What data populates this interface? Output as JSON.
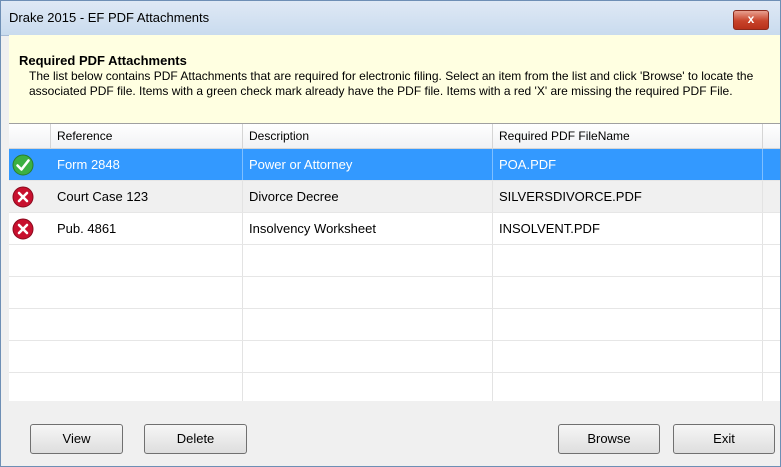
{
  "window": {
    "title": "Drake 2015 - EF PDF Attachments",
    "close_glyph": "x"
  },
  "banner": {
    "title": "Required PDF Attachments",
    "text": "The list below contains PDF Attachments that are required for electronic filing. Select an item from the list and click 'Browse' to locate the associated PDF file. Items with a green check mark already have the PDF file. Items with a red 'X' are missing the required PDF File."
  },
  "table": {
    "columns": [
      "Reference",
      "Description",
      "Required PDF FileName"
    ],
    "rows": [
      {
        "status": "check-icon",
        "reference": "Form 2848",
        "description": "Power or Attorney",
        "filename": "POA.PDF"
      },
      {
        "status": "x-icon",
        "reference": "Court Case 123",
        "description": "Divorce Decree",
        "filename": "SILVERSDIVORCE.PDF"
      },
      {
        "status": "x-icon",
        "reference": "Pub. 4861",
        "description": "Insolvency Worksheet",
        "filename": "INSOLVENT.PDF"
      }
    ]
  },
  "buttons": {
    "view": "View",
    "delete": "Delete",
    "browse": "Browse",
    "exit": "Exit"
  },
  "colors": {
    "selection": "#3399ff",
    "banner": "#ffffe1",
    "check": "#3cb043",
    "x": "#c8102e"
  }
}
